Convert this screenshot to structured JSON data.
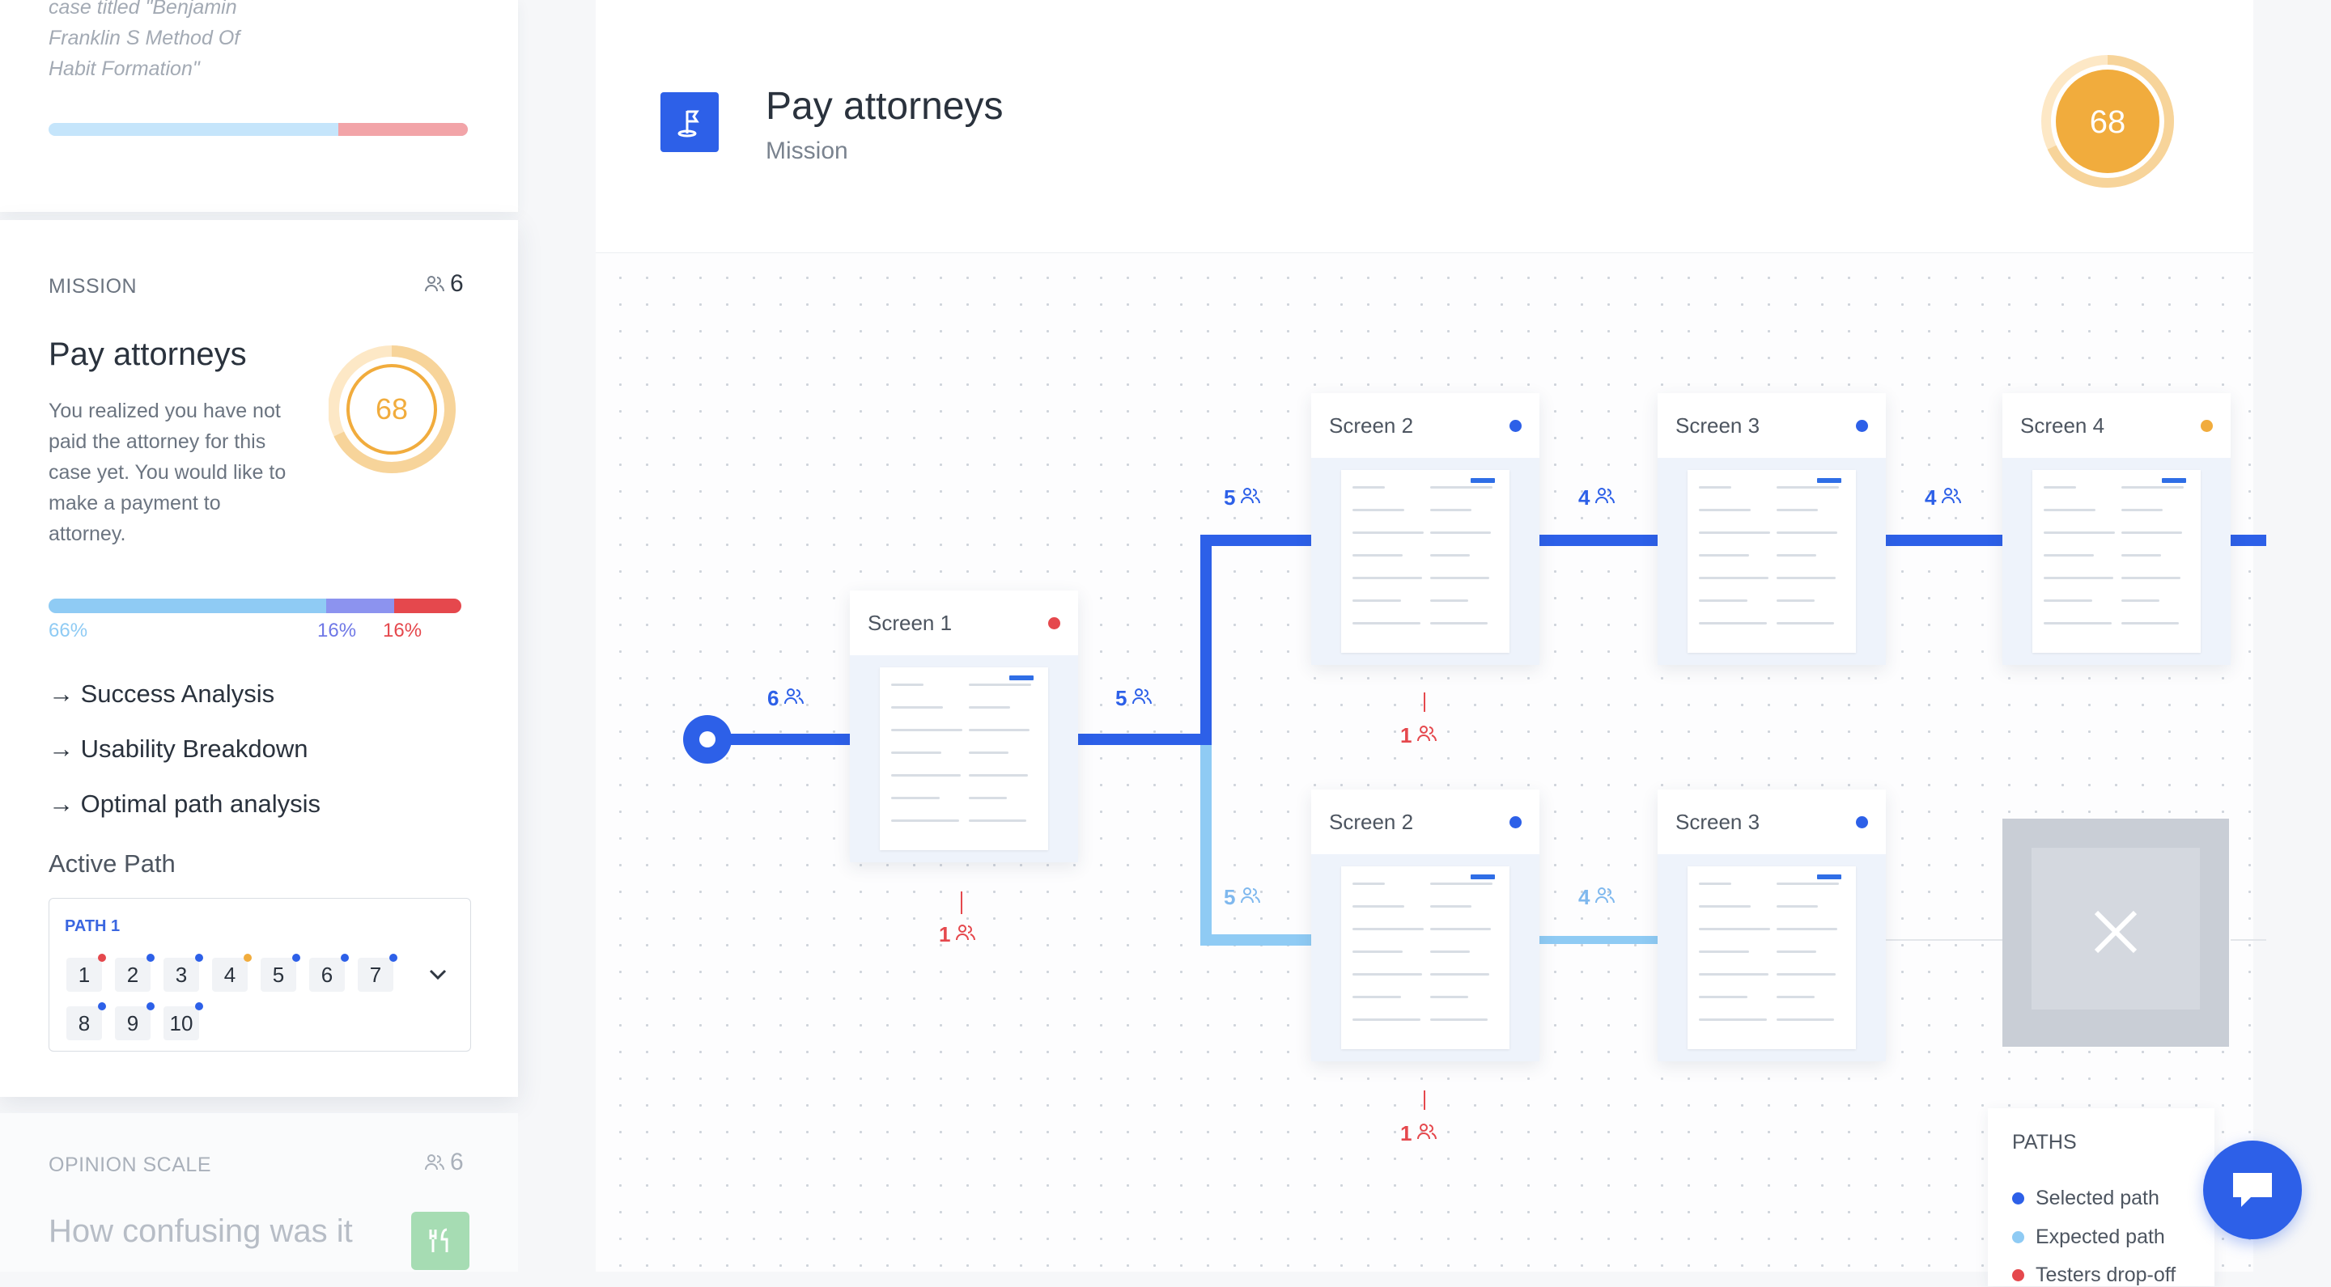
{
  "sidebar": {
    "previous_card": {
      "text": "case titled \"Benjamin Franklin S Method Of Habit Formation\""
    },
    "mission_card": {
      "label": "MISSION",
      "testers": "6",
      "title": "Pay attorneys",
      "description": "You realized you have not paid the attorney for this case yet. You would like to make a payment to attorney.",
      "score": "68",
      "score_fraction": 0.68,
      "breakdown": [
        {
          "pct": "66%",
          "value": 66,
          "color": "#8fcbf4"
        },
        {
          "pct": "16%",
          "value": 16,
          "color": "#8c93ef"
        },
        {
          "pct": "16%",
          "value": 16,
          "color": "#e5484d"
        }
      ],
      "links": [
        "→ Success Analysis",
        "→ Usability Breakdown",
        "→ Optimal path analysis"
      ],
      "active_path_label": "Active Path",
      "path": {
        "name": "PATH 1",
        "steps": [
          {
            "n": "1",
            "status": "#e5484d"
          },
          {
            "n": "2",
            "status": "#2d60e8"
          },
          {
            "n": "3",
            "status": "#2d60e8"
          },
          {
            "n": "4",
            "status": "#f1ac3d"
          },
          {
            "n": "5",
            "status": "#2d60e8"
          },
          {
            "n": "6",
            "status": "#2d60e8"
          },
          {
            "n": "7",
            "status": "#2d60e8"
          },
          {
            "n": "8",
            "status": "#2d60e8"
          },
          {
            "n": "9",
            "status": "#2d60e8"
          },
          {
            "n": "10",
            "status": "#2d60e8"
          }
        ]
      }
    },
    "opinion_card": {
      "label": "OPINION SCALE",
      "testers": "6",
      "title": "How confusing was it"
    }
  },
  "header": {
    "icon": "flag-icon",
    "title": "Pay attorneys",
    "subtitle": "Mission",
    "score": "68",
    "score_fraction": 0.68
  },
  "flow": {
    "screens": {
      "s1": {
        "label": "Screen 1",
        "status": "#e5484d"
      },
      "s2a": {
        "label": "Screen 2",
        "status": "#2d60e8"
      },
      "s3a": {
        "label": "Screen 3",
        "status": "#2d60e8"
      },
      "s4a": {
        "label": "Screen 4",
        "status": "#f1ac3d"
      },
      "s2b": {
        "label": "Screen 2",
        "status": "#2d60e8"
      },
      "s3b": {
        "label": "Screen 3",
        "status": "#2d60e8"
      }
    },
    "counts": {
      "start": "6",
      "to_s2": "5",
      "upper_branch": "5",
      "lower_branch": "5",
      "s2a_s3a": "4",
      "s3a_s4a": "4",
      "s2b_s3b": "4",
      "drop_s1": "1",
      "drop_s2a": "1",
      "drop_s2b": "1"
    }
  },
  "legend": {
    "title": "PATHS",
    "items": [
      {
        "label": "Selected path",
        "color": "#2d60e8"
      },
      {
        "label": "Expected path",
        "color": "#8fcbf4"
      },
      {
        "label": "Testers drop-off",
        "color": "#e5484d"
      }
    ]
  },
  "colors": {
    "primary": "#2d60e8",
    "expected": "#8fcbf4",
    "dropoff": "#e5484d",
    "score": "#f1ac3d"
  }
}
